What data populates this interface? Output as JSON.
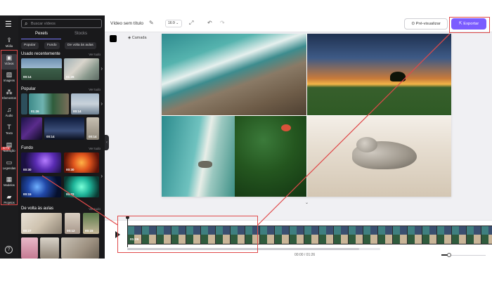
{
  "rail": {
    "items": [
      {
        "label": "Mídia",
        "icon": "upload-icon"
      },
      {
        "label": "Vídeos",
        "icon": "video-icon"
      },
      {
        "label": "Imagens",
        "icon": "image-icon"
      },
      {
        "label": "Elementos",
        "icon": "elements-icon"
      },
      {
        "label": "Áudio",
        "icon": "music-icon"
      },
      {
        "label": "Texto",
        "icon": "text-icon"
      },
      {
        "label": "Narração",
        "icon": "narration-icon"
      },
      {
        "label": "Legendas",
        "icon": "captions-icon"
      },
      {
        "label": "Modelos",
        "icon": "templates-icon"
      },
      {
        "label": "Projetos",
        "icon": "folder-icon"
      }
    ],
    "beta_label": "BETA",
    "help_label": "?"
  },
  "panel": {
    "search_placeholder": "Buscar vídeos",
    "source_tabs": [
      "Pexels",
      "Stocks"
    ],
    "chips": [
      "Popular",
      "Fundo",
      "De volta às aulas"
    ],
    "see_all": "Ver tudo",
    "sections": [
      {
        "title": "Usado recentemente",
        "durations": [
          "00:14",
          "01:26"
        ]
      },
      {
        "title": "Popular",
        "durations": [
          "01:26",
          "00:14",
          "00:14",
          "00:14"
        ]
      },
      {
        "title": "Fundo",
        "durations": [
          "00:30",
          "00:30",
          "00:15",
          "00:32"
        ]
      },
      {
        "title": "De volta às aulas",
        "durations": [
          "00:27",
          "00:12",
          "00:15"
        ]
      }
    ]
  },
  "topbar": {
    "title": "Vídeo sem título",
    "ratio": "16:9",
    "preview_label": "Pré-visualizar",
    "export_label": "Exportar"
  },
  "subbar": {
    "layer_label": "Camada"
  },
  "timeline": {
    "clip_duration": "01:26",
    "timecode": "00:00 / 01:26"
  },
  "colors": {
    "accent": "#7b5cff",
    "highlight": "#e04a4a",
    "panel_bg": "#19191b",
    "rail_bg": "#1c1c1e"
  }
}
